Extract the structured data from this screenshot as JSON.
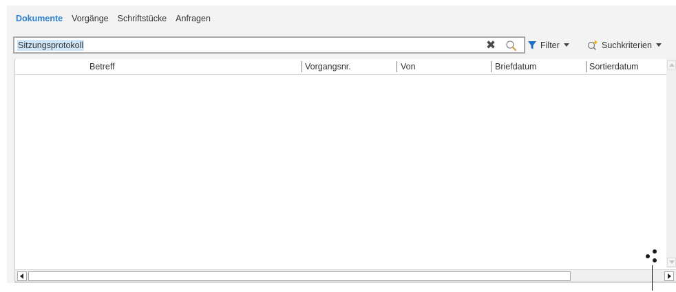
{
  "tabs": {
    "items": [
      {
        "label": "Dokumente",
        "active": true
      },
      {
        "label": "Vorgänge",
        "active": false
      },
      {
        "label": "Schriftstücke",
        "active": false
      },
      {
        "label": "Anfragen",
        "active": false
      }
    ]
  },
  "search": {
    "value": "Sitzungsprotokoll",
    "clear_icon": "close-icon",
    "search_icon": "magnifier-icon"
  },
  "toolbar": {
    "filter_label": "Filter",
    "filter_icon": "funnel-icon",
    "criteria_label": "Suchkriterien",
    "criteria_icon": "search-add-icon"
  },
  "table": {
    "columns": [
      "Betreff",
      "Vorgangsnr.",
      "Von",
      "Briefdatum",
      "Sortierdatum"
    ],
    "rows": []
  },
  "colors": {
    "accent": "#2d7fd0",
    "funnel": "#1e6fc7",
    "selection": "#cfe6f9"
  }
}
